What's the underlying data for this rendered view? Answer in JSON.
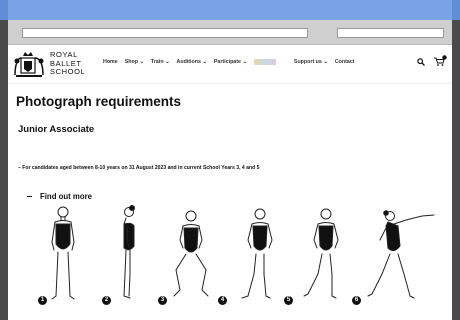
{
  "site": {
    "logo_lines": [
      "ROYAL",
      "BALLET",
      "SCHOOL"
    ],
    "logo_icon": "crest-icon"
  },
  "nav": {
    "items": [
      {
        "label": "Home"
      },
      {
        "label": "Shop"
      },
      {
        "label": "Train"
      },
      {
        "label": "Auditions"
      },
      {
        "label": "Participate"
      },
      {
        "label": "Support us"
      },
      {
        "label": "Contact"
      }
    ],
    "chevron": "⌄",
    "search_icon": "search-icon",
    "cart_icon": "cart-icon"
  },
  "page": {
    "title": "Photograph requirements",
    "section": "Junior Associate",
    "bullet": "– For candidates aged between 8-10 years on 31 August 2023 and in current School Years 3, 4 and 5",
    "find_more": "Find out more"
  },
  "figures": {
    "numbers": [
      "1",
      "2",
      "3",
      "4",
      "5",
      "6"
    ]
  }
}
